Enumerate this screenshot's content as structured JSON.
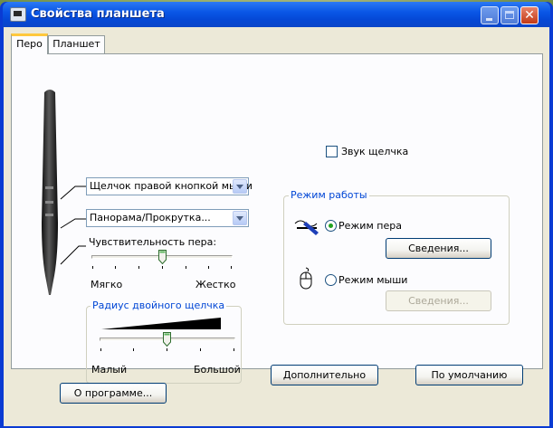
{
  "window": {
    "title": "Свойства планшета"
  },
  "tabs": [
    {
      "label": "Перо"
    },
    {
      "label": "Планшет"
    }
  ],
  "pen": {
    "upper_button_value": "Щелчок правой кнопкой мыши",
    "lower_button_value": "Панорама/Прокрутка...",
    "sensitivity_label": "Чувствительность пера:",
    "sensitivity_min": "Мягко",
    "sensitivity_max": "Жестко",
    "sensitivity_level": 0.5
  },
  "double_click": {
    "group_label": "Радиус двойного щелчка",
    "min_label": "Малый",
    "max_label": "Большой",
    "level": 0.5
  },
  "click_sound": {
    "label": "Звук щелчка",
    "checked": false
  },
  "mode": {
    "group_label": "Режим работы",
    "pen_mode_label": "Режим пера",
    "pen_details_button": "Сведения...",
    "mouse_mode_label": "Режим мыши",
    "mouse_details_button": "Сведения...",
    "selected": "pen"
  },
  "buttons": {
    "advanced": "Дополнительно",
    "defaults": "По умолчанию",
    "about": "О программе..."
  },
  "colors": {
    "accent": "#0046d5",
    "title_bar": "#0a57e6",
    "radio_selected": "#21a121"
  }
}
